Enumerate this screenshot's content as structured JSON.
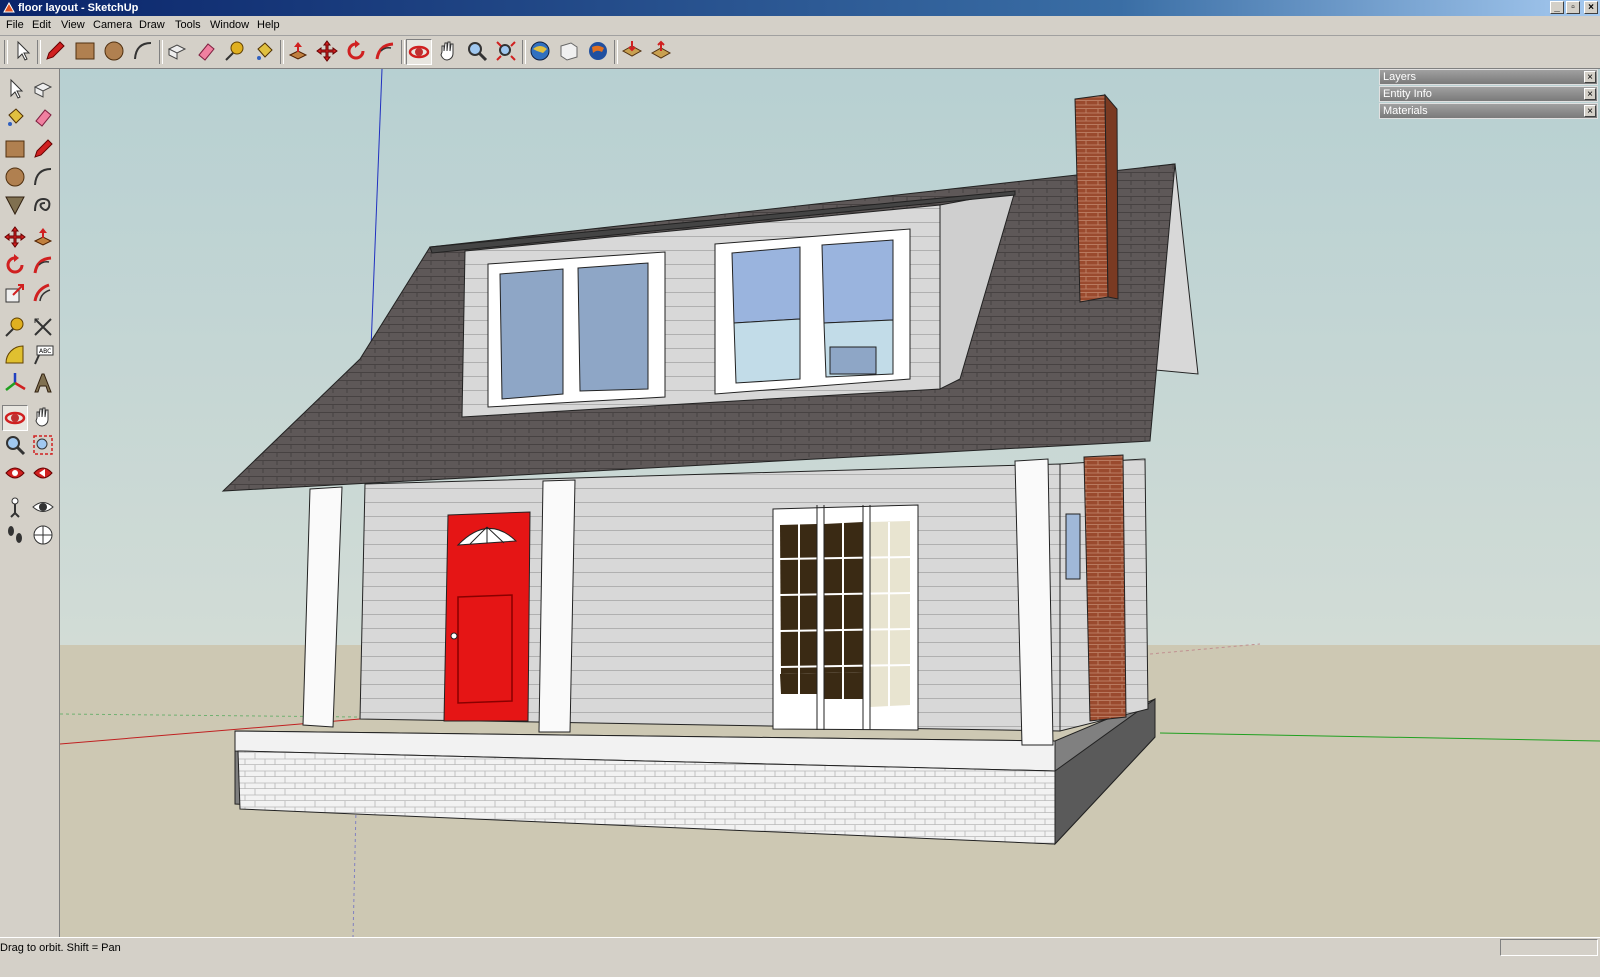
{
  "window": {
    "title": "floor layout - SketchUp",
    "controls": [
      "minimize",
      "maximize",
      "close"
    ]
  },
  "menubar": {
    "items": [
      {
        "label": "File"
      },
      {
        "label": "Edit"
      },
      {
        "label": "View"
      },
      {
        "label": "Camera"
      },
      {
        "label": "Draw"
      },
      {
        "label": "Tools"
      },
      {
        "label": "Window"
      },
      {
        "label": "Help"
      }
    ]
  },
  "toolbar": {
    "tools": [
      {
        "icon": "select-icon"
      },
      {
        "icon": "pencil-icon"
      },
      {
        "icon": "rectangle-icon"
      },
      {
        "icon": "circle-icon"
      },
      {
        "icon": "arc-icon"
      },
      {
        "icon": "make-component-icon"
      },
      {
        "icon": "eraser-icon"
      },
      {
        "icon": "tape-measure-icon"
      },
      {
        "icon": "paint-bucket-icon"
      },
      {
        "icon": "push-pull-icon"
      },
      {
        "icon": "move-icon"
      },
      {
        "icon": "rotate-icon"
      },
      {
        "icon": "follow-me-icon"
      },
      {
        "icon": "orbit-icon",
        "active": true
      },
      {
        "icon": "pan-icon"
      },
      {
        "icon": "zoom-icon"
      },
      {
        "icon": "zoom-extents-icon"
      },
      {
        "icon": "get-models-icon"
      },
      {
        "icon": "share-model-icon"
      },
      {
        "icon": "google-earth-icon"
      },
      {
        "icon": "get-components-icon"
      },
      {
        "icon": "share-component-icon"
      }
    ]
  },
  "lefttoolbar": {
    "tools": [
      {
        "icon": "select-icon"
      },
      {
        "icon": "make-component-icon"
      },
      {
        "icon": "paint-bucket-icon"
      },
      {
        "icon": "eraser-icon"
      },
      {
        "icon": "rectangle-icon"
      },
      {
        "icon": "pencil-icon"
      },
      {
        "icon": "circle-icon"
      },
      {
        "icon": "arc-icon"
      },
      {
        "icon": "polygon-icon"
      },
      {
        "icon": "freehand-icon"
      },
      {
        "icon": "move-icon"
      },
      {
        "icon": "push-pull-icon"
      },
      {
        "icon": "rotate-icon"
      },
      {
        "icon": "follow-me-icon"
      },
      {
        "icon": "scale-icon"
      },
      {
        "icon": "offset-icon"
      },
      {
        "icon": "tape-measure-icon"
      },
      {
        "icon": "dimension-icon"
      },
      {
        "icon": "protractor-icon"
      },
      {
        "icon": "text-icon"
      },
      {
        "icon": "axes-icon"
      },
      {
        "icon": "3d-text-icon"
      },
      {
        "icon": "orbit-icon",
        "active": true
      },
      {
        "icon": "pan-icon"
      },
      {
        "icon": "zoom-icon"
      },
      {
        "icon": "zoom-window-icon"
      },
      {
        "icon": "zoom-extents-icon"
      },
      {
        "icon": "previous-view-icon"
      },
      {
        "icon": "position-camera-icon"
      },
      {
        "icon": "look-around-icon"
      },
      {
        "icon": "walk-icon"
      },
      {
        "icon": "section-plane-icon"
      }
    ]
  },
  "trays": [
    {
      "label": "Layers"
    },
    {
      "label": "Entity Info"
    },
    {
      "label": "Materials"
    }
  ],
  "colors": {
    "sky": "#bfd5d6",
    "ground": "#cdc8b4",
    "roof": "#5a5555",
    "siding": "#d9d9d9",
    "door": "#e01010",
    "brick": "#9c4a2e",
    "window_glass": "#8fa8cc"
  },
  "statusbar": {
    "text": "Drag to orbit.  Shift = Pan",
    "measurements_value": ""
  }
}
